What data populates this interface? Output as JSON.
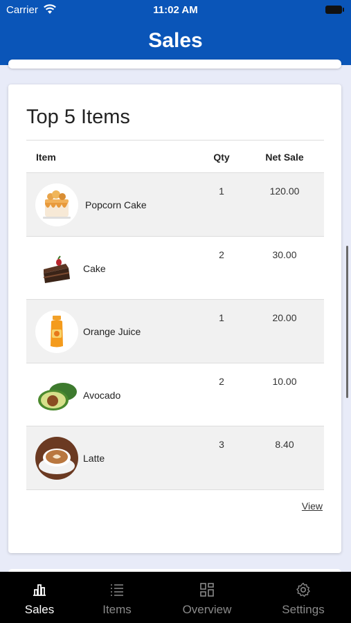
{
  "status_bar": {
    "carrier": "Carrier",
    "time": "11:02 AM"
  },
  "nav": {
    "title": "Sales"
  },
  "top_items": {
    "title": "Top 5 Items",
    "headers": {
      "item": "Item",
      "qty": "Qty",
      "net_sale": "Net Sale"
    },
    "rows": [
      {
        "name": "Popcorn Cake",
        "qty": "1",
        "net_sale": "120.00",
        "image": "popcorn-cake-image"
      },
      {
        "name": "Cake",
        "qty": "2",
        "net_sale": "30.00",
        "image": "cake-image"
      },
      {
        "name": "Orange Juice",
        "qty": "1",
        "net_sale": "20.00",
        "image": "orange-juice-image"
      },
      {
        "name": "Avocado",
        "qty": "2",
        "net_sale": "10.00",
        "image": "avocado-image"
      },
      {
        "name": "Latte",
        "qty": "3",
        "net_sale": "8.40",
        "image": "latte-image"
      }
    ],
    "view_label": "View"
  },
  "tabs": [
    {
      "label": "Sales",
      "icon": "bar-chart-icon",
      "active": true
    },
    {
      "label": "Items",
      "icon": "list-icon",
      "active": false
    },
    {
      "label": "Overview",
      "icon": "grid-icon",
      "active": false
    },
    {
      "label": "Settings",
      "icon": "gear-icon",
      "active": false
    }
  ],
  "colors": {
    "nav_bg": "#0a55b8",
    "page_bg": "#e8ebf8",
    "tabbar_bg": "#000000",
    "row_shade": "#f1f1f1"
  }
}
